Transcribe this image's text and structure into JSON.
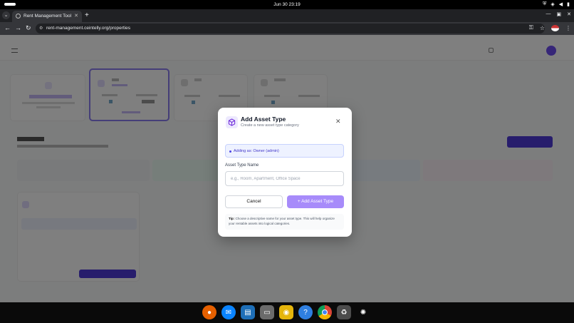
{
  "os": {
    "clock": "Jun 30  23:19"
  },
  "browser": {
    "tab_title": "Rent Management Tool",
    "url": "rent-management.ceintelly.org/properties"
  },
  "modal": {
    "title": "Add Asset Type",
    "subtitle": "Create a new asset type category",
    "adding_as": "Adding as: Owner (admin)",
    "field_label": "Asset Type Name",
    "field_placeholder": "e.g., Room, Apartment, Office Space",
    "cancel_label": "Cancel",
    "add_label": "+ Add Asset Type",
    "tip_label": "Tip:",
    "tip_text": "Choose a descriptive name for your asset type. This will help organize your rentable assets into logical categories."
  },
  "colors": {
    "accent": "#a78bfa",
    "brand": "#4f3ad8",
    "info_bg": "#eef2ff"
  },
  "dock": [
    "firefox-icon",
    "thunderbird-icon",
    "writer-icon",
    "files-icon",
    "rhythmbox-icon",
    "help-icon",
    "chrome-icon",
    "trash-icon",
    "ubuntu-icon"
  ]
}
